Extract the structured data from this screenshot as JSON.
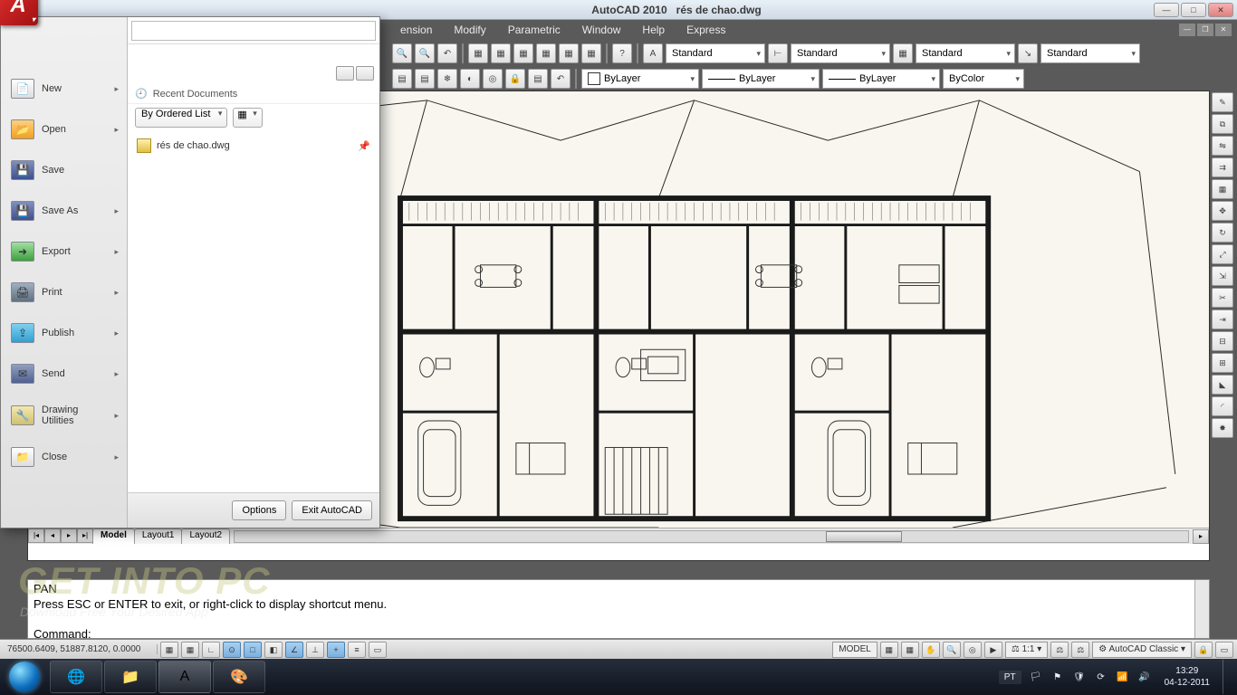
{
  "window": {
    "app_name": "AutoCAD 2010",
    "doc_name": "rés de chao.dwg"
  },
  "menus": [
    "ension",
    "Modify",
    "Parametric",
    "Window",
    "Help",
    "Express"
  ],
  "style_combos": {
    "text": "Standard",
    "dim": "Standard",
    "table": "Standard",
    "multileader": "Standard"
  },
  "layer_combos": {
    "layer": "ByLayer",
    "linetype": "ByLayer",
    "lineweight": "ByLayer",
    "plotstyle": "ByColor"
  },
  "app_menu": {
    "items": [
      {
        "label": "New",
        "icon": "new",
        "sub": true
      },
      {
        "label": "Open",
        "icon": "open",
        "sub": true
      },
      {
        "label": "Save",
        "icon": "save",
        "sub": false
      },
      {
        "label": "Save As",
        "icon": "save",
        "sub": true
      },
      {
        "label": "Export",
        "icon": "export",
        "sub": true
      },
      {
        "label": "Print",
        "icon": "print",
        "sub": true
      },
      {
        "label": "Publish",
        "icon": "publish",
        "sub": true
      },
      {
        "label": "Send",
        "icon": "send",
        "sub": true
      },
      {
        "label": "Drawing\nUtilities",
        "icon": "util",
        "sub": true
      },
      {
        "label": "Close",
        "icon": "close",
        "sub": true
      }
    ],
    "recent_header": "Recent Documents",
    "sort_label": "By Ordered List",
    "recent": [
      {
        "name": "rés de chao.dwg"
      }
    ],
    "footer": {
      "options": "Options",
      "exit": "Exit AutoCAD"
    }
  },
  "layout_tabs": [
    "Model",
    "Layout1",
    "Layout2"
  ],
  "cmdline": {
    "l1": "PAN",
    "l2": "Press ESC or ENTER to exit, or right-click to display shortcut menu.",
    "l3": "",
    "prompt": "Command:"
  },
  "status": {
    "coords": "76500.6409, 51887.8120, 0.0000",
    "model": "MODEL",
    "scale": "1:1",
    "workspace": "AutoCAD Classic"
  },
  "taskbar": {
    "lang": "PT",
    "time": "13:29",
    "date": "04-12-2011"
  },
  "watermark": {
    "big": "GET INTO PC",
    "sub": "Download Free Your Desired App"
  }
}
